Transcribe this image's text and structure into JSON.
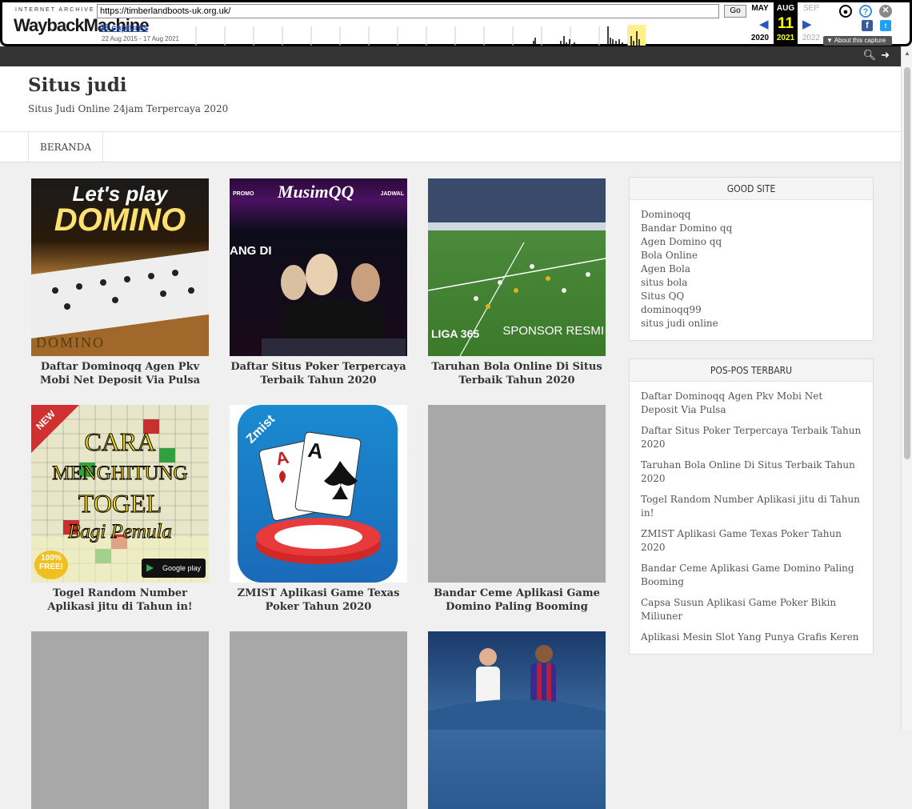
{
  "wayback": {
    "ia_label": "INTERNET ARCHIVE",
    "logo_text": "WaybackMachine",
    "url": "https://timberlandboots-uk.org.uk/",
    "go_label": "Go",
    "captures": "48 captures",
    "date_range": "22 Aug 2015 - 17 Aug 2021",
    "prev_month": "MAY",
    "cur_month": "AUG",
    "next_month": "SEP",
    "day": "11",
    "prev_year": "2020",
    "cur_year": "2021",
    "next_year": "2022",
    "about": "About this capture",
    "colors": {
      "highlight": "#ffff00",
      "link": "#2a55bb"
    }
  },
  "site": {
    "title": "Situs judi",
    "description": "Situs Judi Online 24jam Terpercaya 2020",
    "icons": [
      "search-icon",
      "sign-in-icon"
    ]
  },
  "nav": {
    "items": [
      "BERANDA"
    ]
  },
  "posts": [
    {
      "title": "Daftar Dominoqq Agen Pkv Mobi Net Deposit Via Pulsa",
      "img_text": [
        "Let's play",
        "DOMINO",
        "DOMINO"
      ]
    },
    {
      "title": "Daftar Situs Poker Terpercaya Terbaik Tahun 2020",
      "img_text": [
        "PROMO",
        "MusimQQ",
        "JADWAL",
        "ANG DI"
      ]
    },
    {
      "title": "Taruhan Bola Online Di Situs Terbaik Tahun 2020",
      "img_text": [
        "LIGA 365",
        "SPONSOR RESMI"
      ]
    },
    {
      "title": "Togel Random Number Aplikasi jitu di Tahun in!",
      "img_text": [
        "NEW",
        "CARA",
        "MENGHITUNG",
        "TOGEL",
        "Bagi Pemula",
        "100% FREE!",
        "Google play"
      ]
    },
    {
      "title": "ZMIST Aplikasi Game Texas Poker Tahun 2020",
      "img_text": [
        "Zmist",
        "A",
        "A"
      ]
    },
    {
      "title": "Bandar Ceme Aplikasi Game Domino Paling Booming",
      "img_text": []
    },
    {
      "title": "",
      "img_text": []
    },
    {
      "title": "",
      "img_text": []
    },
    {
      "title": "",
      "img_text": []
    }
  ],
  "widgets": {
    "good_site": {
      "heading": "GOOD SITE",
      "links": [
        "Dominoqq",
        "Bandar Domino qq",
        "Agen Domino qq",
        "Bola Online",
        "Agen Bola",
        "situs bola",
        "Situs QQ",
        "dominoqq99",
        "situs judi online"
      ]
    },
    "recent_posts": {
      "heading": "POS-POS TERBARU",
      "links": [
        "Daftar Dominoqq Agen Pkv Mobi Net Deposit Via Pulsa",
        "Daftar Situs Poker Terpercaya Terbaik Tahun 2020",
        "Taruhan Bola Online Di Situs Terbaik Tahun 2020",
        "Togel Random Number Aplikasi jitu di Tahun in!",
        "ZMIST Aplikasi Game Texas Poker Tahun 2020",
        "Bandar Ceme Aplikasi Game Domino Paling Booming",
        "Capsa Susun Aplikasi Game Poker Bikin Miliuner",
        "Aplikasi Mesin Slot Yang Punya Grafis Keren"
      ]
    }
  }
}
